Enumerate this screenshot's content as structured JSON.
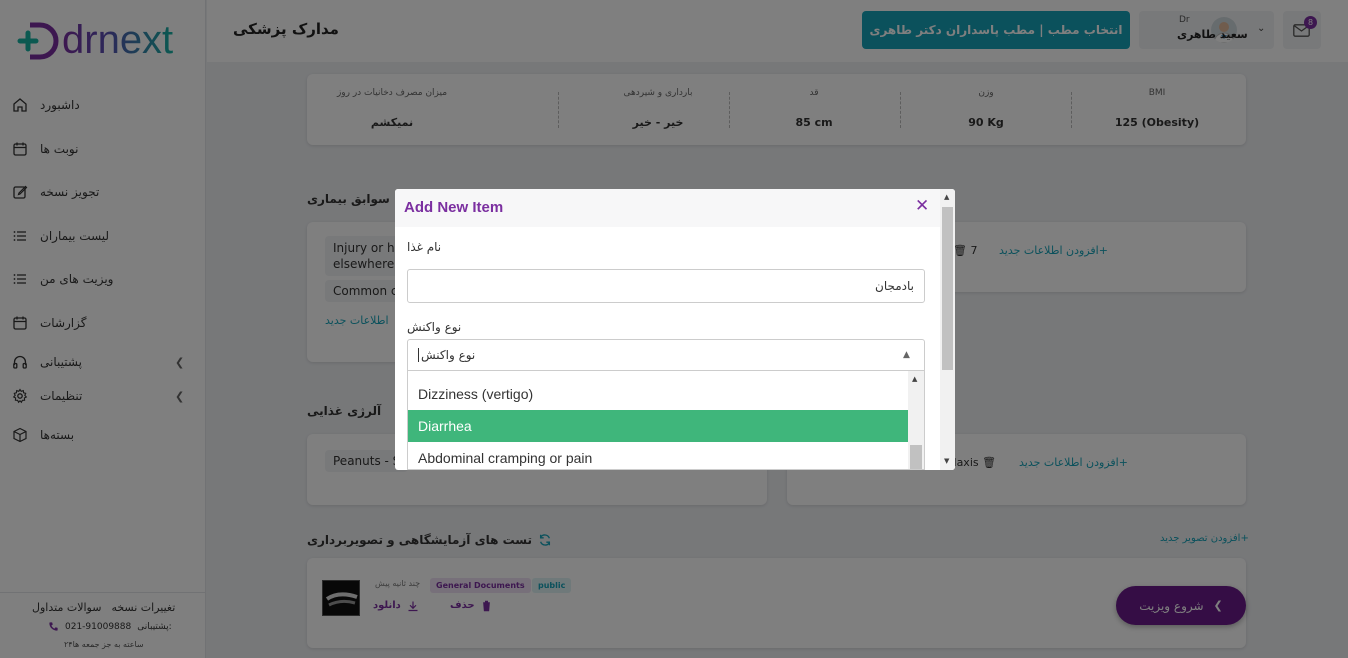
{
  "sidebar": {
    "logo_text": "drnext",
    "items": [
      {
        "label": "داشبورد"
      },
      {
        "label": "نوبت ها"
      },
      {
        "label": "تجویز نسخه"
      },
      {
        "label": "لیست بیماران"
      },
      {
        "label": "ویزیت های من"
      },
      {
        "label": "گزارشات"
      },
      {
        "label": "پشتیبانی"
      },
      {
        "label": "تنظیمات"
      },
      {
        "label": "بسته‌ها"
      }
    ],
    "footer": {
      "faq": "سوالات متداول",
      "changes": "تغییرات نسخه",
      "support_label": "پشتیبانی:",
      "support_phone": "021-91009888",
      "hours": "۲۴ساعته به جز جمعه ها"
    }
  },
  "header": {
    "page_title": "مدارک پزشکی",
    "clinic_button": "انتخاب مطب | مطب پاسداران دکتر طاهری",
    "user_prefix": "Dr",
    "user_name": "سعید طاهری",
    "mail_count": "8"
  },
  "stats": [
    {
      "label": "BMI",
      "value": "125 (Obesity)"
    },
    {
      "label": "وزن",
      "value": "90 Kg"
    },
    {
      "label": "قد",
      "value": "85 cm"
    },
    {
      "label": "بارداری و شیردهی",
      "value": "خیر - خیر"
    },
    {
      "label": "میزان مصرف دخانیات در روز",
      "value": "نمیکشم"
    }
  ],
  "history": {
    "title": "سوابق بیماری",
    "chips": [
      "Injury or ho",
      "elsewhere",
      "Common c"
    ],
    "add_link_partial": "اطلاعات جدید",
    "right_add_link": "+افزودن اطلاعات جدید",
    "right_chip_partial": "7"
  },
  "allergy": {
    "title": "آلرژی غذایی",
    "chip": "Peanuts - S",
    "right_add_link": "+افزودن اطلاعات جدید",
    "right_chip_partial": "ylaxis"
  },
  "lab": {
    "title": "تست های آزمایشگاهی و تصویربرداری",
    "add_image_link": "+افزودن تصویر جدید",
    "tag_public": "public",
    "tag_general": "General Documents",
    "time_ago": "چند ثانیه پیش",
    "delete_label": "حذف",
    "download_label": "دانلود"
  },
  "fab": {
    "label": "شروع ویزیت"
  },
  "modal": {
    "title": "Add New Item",
    "food_label": "نام غذا",
    "food_value": "بادمجان",
    "reaction_label": "نوع واکنش",
    "reaction_placeholder": "نوع واکنش",
    "options": [
      "Dizziness (vertigo)",
      "Diarrhea",
      "Abdominal cramping or pain"
    ],
    "selected_option": "Diarrhea"
  },
  "colors": {
    "brand_purple": "#7b2fa0",
    "teal": "#17a2b8",
    "option_active": "#3fb67b"
  }
}
